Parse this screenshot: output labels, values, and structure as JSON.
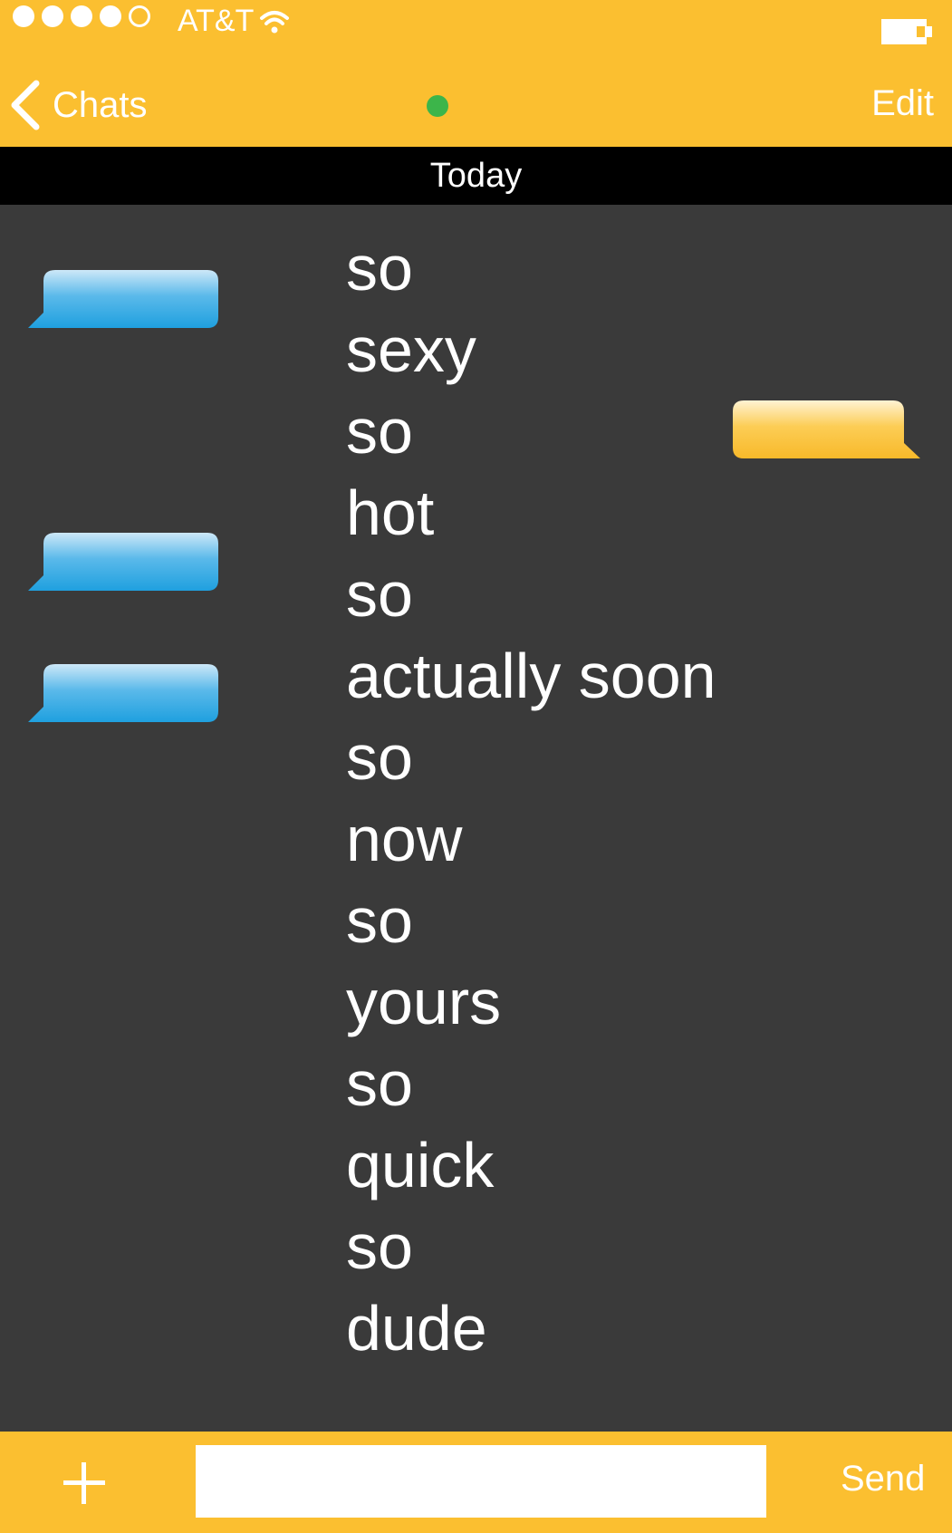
{
  "status": {
    "signal_dots_filled": 4,
    "signal_dots_total": 5,
    "carrier": "AT&T",
    "wifi_icon": "wifi-icon",
    "battery_icon": "battery-icon"
  },
  "nav": {
    "back_label": "Chats",
    "back_icon": "chevron-left-icon",
    "presence": "online",
    "edit_label": "Edit"
  },
  "date_label": "Today",
  "messages": [
    "so",
    "sexy",
    "so",
    "hot",
    "so",
    "actually soon",
    "so",
    "now",
    "so",
    "yours",
    "so",
    "quick",
    "so",
    "dude"
  ],
  "bubbles": [
    {
      "side": "left",
      "color": "blue"
    },
    {
      "side": "right",
      "color": "yellow"
    },
    {
      "side": "left",
      "color": "blue"
    },
    {
      "side": "left",
      "color": "blue"
    }
  ],
  "input": {
    "value": "",
    "placeholder": ""
  },
  "send_label": "Send",
  "add_icon": "plus-icon",
  "colors": {
    "bar": "#fbbf30",
    "background": "#3a3a3a",
    "date_bar": "#000000",
    "online": "#3cb54a",
    "blue_bubble": "#29a6e2",
    "yellow_bubble": "#fbbf30"
  }
}
